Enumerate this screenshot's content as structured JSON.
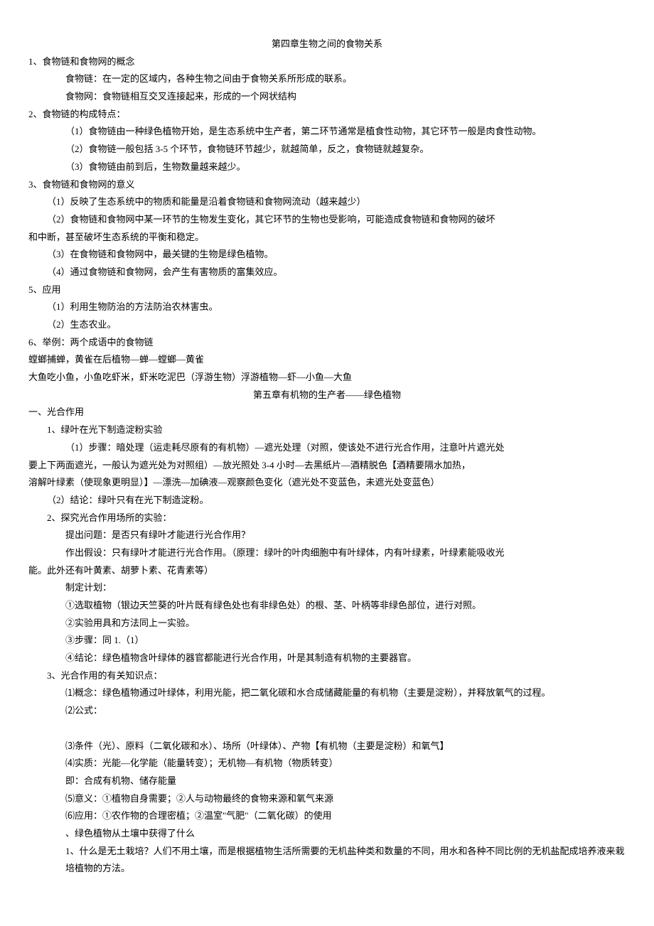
{
  "ch4": {
    "title": "第四章生物之间的食物关系",
    "s1_title": "1、食物链和食物网的概念",
    "s1_l1": "食物链：在一定的区域内，各种生物之间由于食物关系所形成的联系。",
    "s1_l2": "食物网：食物链相互交叉连接起来，形成的一个网状结构",
    "s2_title": "2、食物链的构成特点：",
    "s2_l1": "（1）食物链由一种绿色植物开始，是生态系统中生产者，第二环节通常是植食性动物，其它环节一般是肉食性动物。",
    "s2_l2": "（2）食物链一般包括 3-5 个环节，食物链环节越少，就越简单，反之，食物链就越复杂。",
    "s2_l3": "（3）食物链由前到后，生物数量越来越少。",
    "s3_title": "3、食物链和食物网的意义",
    "s3_l1": "（1）反映了生态系统中的物质和能量是沿着食物链和食物网流动（越来越少）",
    "s3_l2": "（2）食物链和食物网中某一环节的生物发生变化，其它环节的生物也受影响，可能造成食物链和食物网的破坏",
    "s3_l2b": "和中断，甚至破坏生态系统的平衡和稳定。",
    "s3_l3": "（3）在食物链和食物网中，最关键的生物是绿色植物。",
    "s3_l4": "（4）通过食物链和食物网，会产生有害物质的富集效应。",
    "s5_title": "5、应用",
    "s5_l1": "（1）利用生物防治的方法防治农林害虫。",
    "s5_l2": "（2）生态农业。",
    "s6_title": "6、举例：两个成语中的食物链",
    "s6_l1": "螳螂捕蝉，黄雀在后植物—蝉—螳螂—黄雀",
    "s6_l2": "大鱼吃小鱼，小鱼吃虾米，虾米吃泥巴（浮游生物）浮游植物—虾—小鱼—大鱼"
  },
  "ch5": {
    "title": "第五章有机物的生产者——绿色植物",
    "p1_title": "一、光合作用",
    "p1_1": "1、绿叶在光下制造淀粉实验",
    "p1_1_l1": "（1）步骤：暗处理（运走耗尽原有的有机物）—遮光处理（对照，使该处不进行光合作用，注意叶片遮光处",
    "p1_1_l2": "要上下两面遮光，一般认为遮光处为对照组）—放光照处 3-4 小时—去黑纸片—酒精脱色【酒精要隔水加热，",
    "p1_1_l3": "溶解叶绿素（使现象更明显）】—漂洗—加碘液—观察颜色变化（遮光处不变蓝色，未遮光处变蓝色）",
    "p1_1_l4": "（2）结论：绿叶只有在光下制造淀粉。",
    "p1_2": "2、探究光合作用场所的实验：",
    "p1_2_l1": "提出问题：是否只有绿叶才能进行光合作用？",
    "p1_2_l2": "作出假设：只有绿叶才能进行光合作用。（原理：绿叶的叶肉细胞中有叶绿体，内有叶绿素，叶绿素能吸收光",
    "p1_2_l3": "能。此外还有叶黄素、胡萝卜素、花青素等）",
    "p1_2_l4": "制定计划：",
    "p1_2_l5": "①选取植物（银边天竺葵的叶片既有绿色处也有非绿色处）的根、茎、叶柄等非绿色部位，进行对照。",
    "p1_2_l6": "②实验用具和方法同上一实验。",
    "p1_2_l7": "③步骤：同 1.（1）",
    "p1_2_l8": "④结论：绿色植物含叶绿体的器官都能进行光合作用，叶是其制造有机物的主要器官。",
    "p1_3": "3、光合作用的有关知识点：",
    "p1_3_l1": "⑴概念：绿色植物通过叶绿体，利用光能，把二氧化碳和水合成储藏能量的有机物（主要是淀粉），并释放氧气的过程。",
    "p1_3_l2": "⑵公式：",
    "p1_3_l3": "⑶条件（光）、原料（二氧化碳和水）、场所（叶绿体）、产物【有机物（主要是淀粉）和氧气】",
    "p1_3_l4": "⑷实质：光能—化学能（能量转变）；无机物—有机物（物质转变）",
    "p1_3_l5": "即：合成有机物、储存能量",
    "p1_3_l6": "⑸意义：①植物自身需要；②人与动物最终的食物来源和氧气来源",
    "p1_3_l7": "⑹应用：①农作物的合理密植；②温室\"气肥\"（二氧化碳）的使用",
    "p2_title": "、绿色植物从土壤中获得了什么",
    "p2_l1": "1、什么是无土栽培？人们不用土壤，而是根据植物生活所需要的无机盐种类和数量的不同，用水和各种不同比例的无机盐配成培养液来栽培植物的方法。"
  }
}
